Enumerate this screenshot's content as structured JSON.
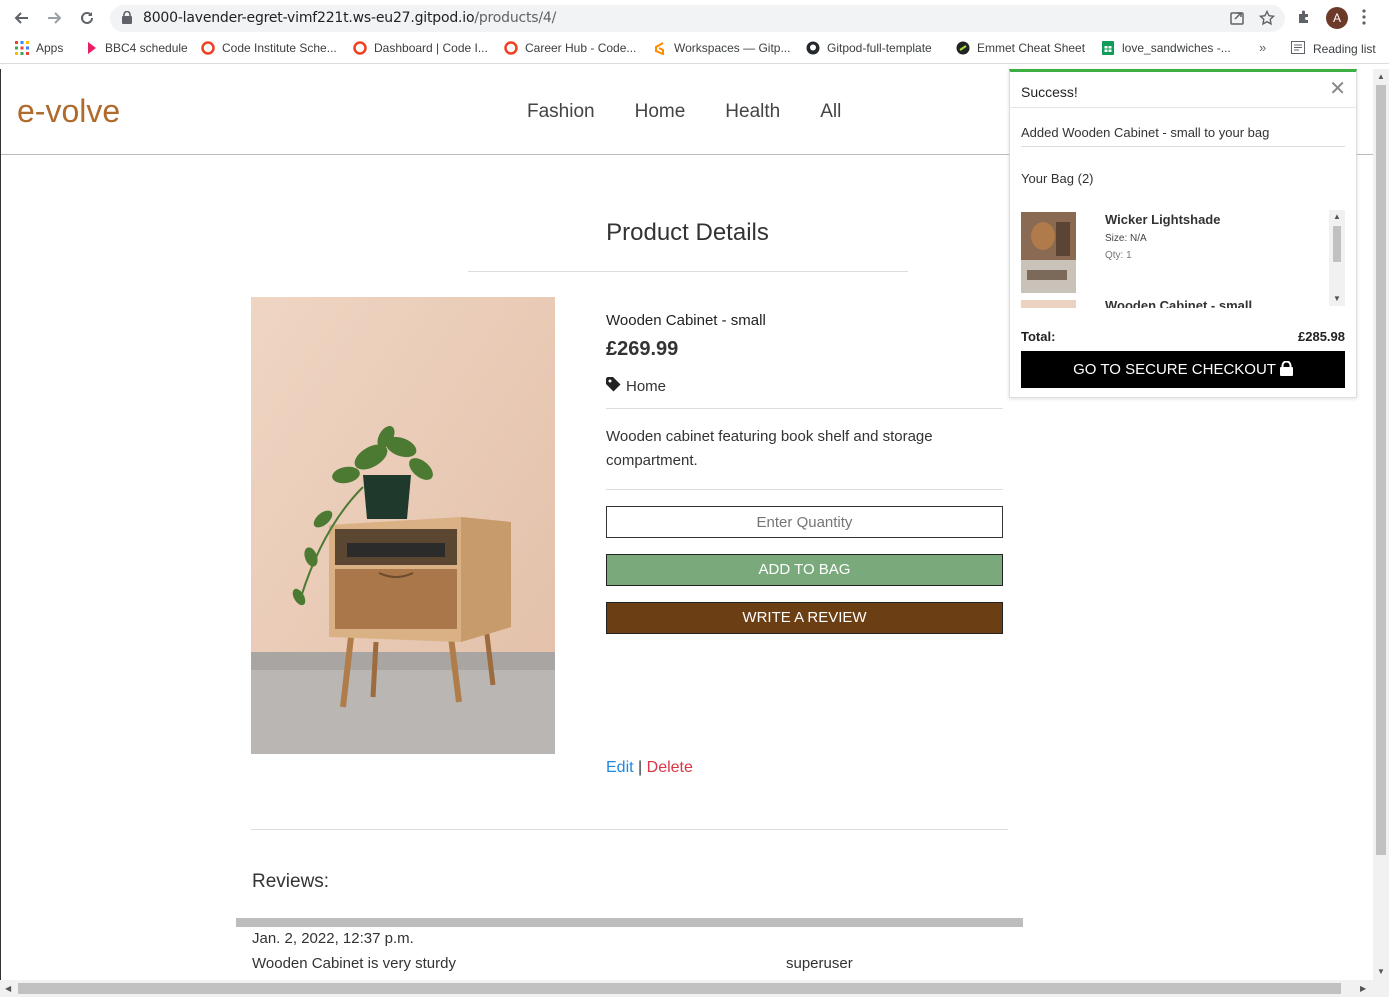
{
  "browser": {
    "url_host": "8000-lavender-egret-vimf221t.ws-eu27.gitpod.io",
    "url_path": "/products/4/",
    "avatar_initial": "A",
    "bookmarks": [
      {
        "label": "Apps",
        "icon": "apps-grid-icon",
        "color": "#4285f4"
      },
      {
        "label": "BBC4 schedule",
        "icon": "bbc4-icon",
        "color": "#e91e63"
      },
      {
        "label": "Code Institute Sche...",
        "icon": "code-institute-icon",
        "color": "#ef4023"
      },
      {
        "label": "Dashboard | Code I...",
        "icon": "code-institute-icon",
        "color": "#ef4023"
      },
      {
        "label": "Career Hub - Code...",
        "icon": "code-institute-icon",
        "color": "#ef4023"
      },
      {
        "label": "Workspaces — Gitp...",
        "icon": "gitpod-icon",
        "color": "#ff8a00"
      },
      {
        "label": "Gitpod-full-template",
        "icon": "github-icon",
        "color": "#24292e"
      },
      {
        "label": "Emmet Cheat Sheet",
        "icon": "emmet-icon",
        "color": "#222222"
      },
      {
        "label": "love_sandwiches -...",
        "icon": "sheets-icon",
        "color": "#0f9d58"
      }
    ],
    "more": "»",
    "reading_list": "Reading list"
  },
  "site": {
    "brand": "e-volve",
    "brand_color": "#b06a2c",
    "nav": [
      "Fashion",
      "Home",
      "Health",
      "All"
    ]
  },
  "product": {
    "page_title": "Product Details",
    "name": "Wooden Cabinet - small",
    "price": "£269.99",
    "category": "Home",
    "description": "Wooden cabinet featuring book shelf and storage compartment.",
    "quantity_placeholder": "Enter Quantity",
    "add_to_bag": "ADD TO BAG",
    "write_review": "WRITE A REVIEW",
    "edit": "Edit",
    "separator": "|",
    "delete": "Delete",
    "add_color": "#7aaa7c",
    "review_color": "#6b3e14"
  },
  "reviews": {
    "title": "Reviews:",
    "items": [
      {
        "date": "Jan. 2, 2022, 12:37 p.m.",
        "text": "Wooden Cabinet is very sturdy",
        "user": "superuser"
      }
    ]
  },
  "toast": {
    "title": "Success!",
    "message": "Added Wooden Cabinet - small to your bag",
    "bag_label": "Your Bag (2)",
    "items": [
      {
        "name": "Wicker Lightshade",
        "size": "Size: N/A",
        "qty": "Qty: 1"
      },
      {
        "name": "Wooden Cabinet - small"
      }
    ],
    "total_label": "Total:",
    "total_value": "£285.98",
    "checkout": "GO TO SECURE CHECKOUT",
    "accent": "#3cb043"
  }
}
